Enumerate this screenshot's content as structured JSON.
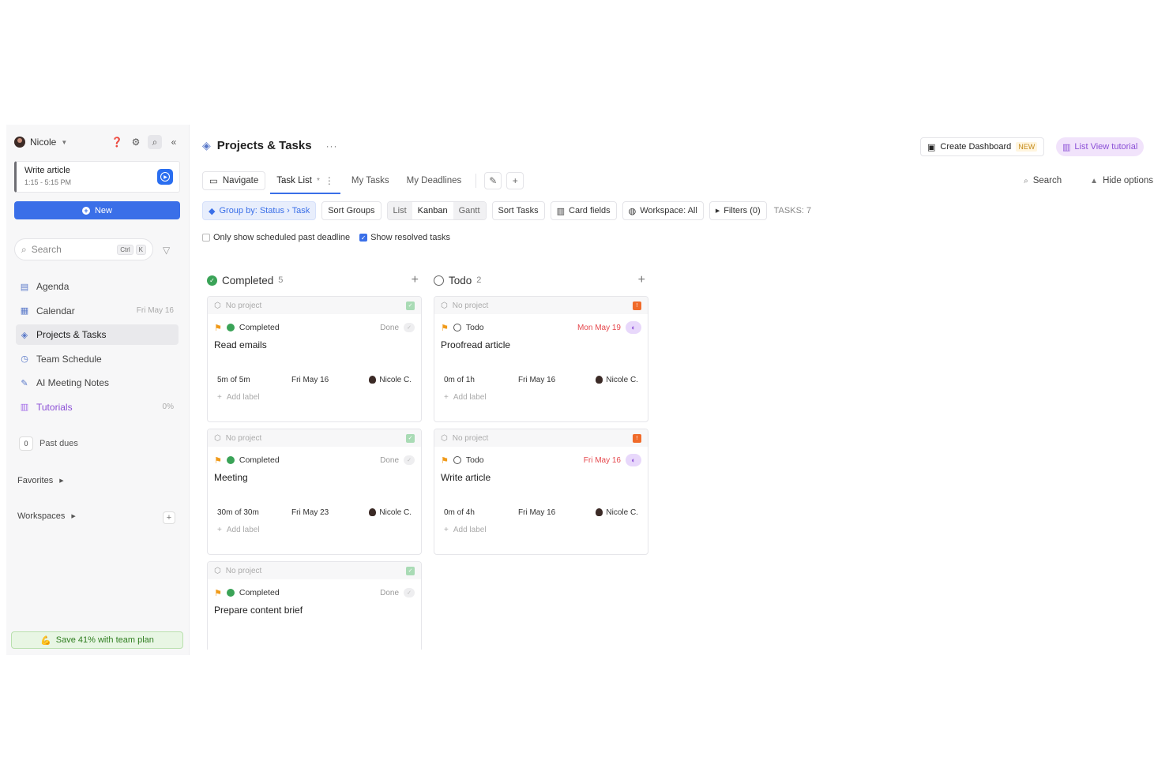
{
  "sidebar": {
    "user": "Nicole",
    "current_task": {
      "title": "Write article",
      "time": "1:15 - 5:15 PM"
    },
    "new_label": "New",
    "search": {
      "placeholder": "Search",
      "kbd1": "Ctrl",
      "kbd2": "K"
    },
    "items": [
      {
        "label": "Agenda",
        "icon": "agenda-icon",
        "meta": ""
      },
      {
        "label": "Calendar",
        "icon": "calendar-icon",
        "meta": "Fri May 16"
      },
      {
        "label": "Projects & Tasks",
        "icon": "cube-icon",
        "meta": ""
      },
      {
        "label": "Team Schedule",
        "icon": "team-schedule-icon",
        "meta": ""
      },
      {
        "label": "AI Meeting Notes",
        "icon": "notes-icon",
        "meta": ""
      },
      {
        "label": "Tutorials",
        "icon": "book-icon",
        "meta": "0%"
      }
    ],
    "past_dues": {
      "count": "0",
      "label": "Past dues"
    },
    "favorites": "Favorites",
    "workspaces": "Workspaces",
    "promo": "Save 41% with team plan"
  },
  "header": {
    "title": "Projects & Tasks",
    "dashboard": "Create Dashboard",
    "new_badge": "NEW",
    "tutorial": "List View tutorial"
  },
  "tabs": {
    "navigate": "Navigate",
    "task_list": "Task List",
    "asterisk": "*",
    "my_tasks": "My Tasks",
    "my_deadlines": "My Deadlines",
    "search": "Search",
    "hide_options": "Hide options"
  },
  "toolbar": {
    "group_by": "Group by: Status › Task",
    "sort_groups": "Sort Groups",
    "views": [
      "List",
      "Kanban",
      "Gantt"
    ],
    "sort_tasks": "Sort Tasks",
    "card_fields": "Card fields",
    "workspace": "Workspace: All",
    "filters": "Filters (0)",
    "tasks_count": "TASKS: 7"
  },
  "checks": {
    "past_deadline": "Only show scheduled past deadline",
    "resolved": "Show resolved tasks"
  },
  "columns": [
    {
      "title": "Completed",
      "count": "5",
      "cards": [
        {
          "project": "No project",
          "status": "Completed",
          "right": "Done",
          "name": "Read emails",
          "duration": "5m of 5m",
          "date": "Fri May 16",
          "assignee": "Nicole C.",
          "add_label": "Add label"
        },
        {
          "project": "No project",
          "status": "Completed",
          "right": "Done",
          "name": "Meeting",
          "duration": "30m of 30m",
          "date": "Fri May 23",
          "assignee": "Nicole C.",
          "add_label": "Add label"
        },
        {
          "project": "No project",
          "status": "Completed",
          "right": "Done",
          "name": "Prepare content brief",
          "duration": "",
          "date": "",
          "assignee": "",
          "add_label": ""
        }
      ]
    },
    {
      "title": "Todo",
      "count": "2",
      "cards": [
        {
          "project": "No project",
          "status": "Todo",
          "right": "Mon May 19",
          "name": "Proofread article",
          "duration": "0m of 1h",
          "date": "Fri May 16",
          "assignee": "Nicole C.",
          "add_label": "Add label"
        },
        {
          "project": "No project",
          "status": "Todo",
          "right": "Fri May 16",
          "name": "Write article",
          "duration": "0m of 4h",
          "date": "Fri May 16",
          "assignee": "Nicole C.",
          "add_label": "Add label"
        }
      ]
    }
  ],
  "colors": {
    "accent": "#3a6fe8",
    "done": "#3aa357",
    "urgent": "#e5484d",
    "tutorial": "#8b4fd6"
  }
}
